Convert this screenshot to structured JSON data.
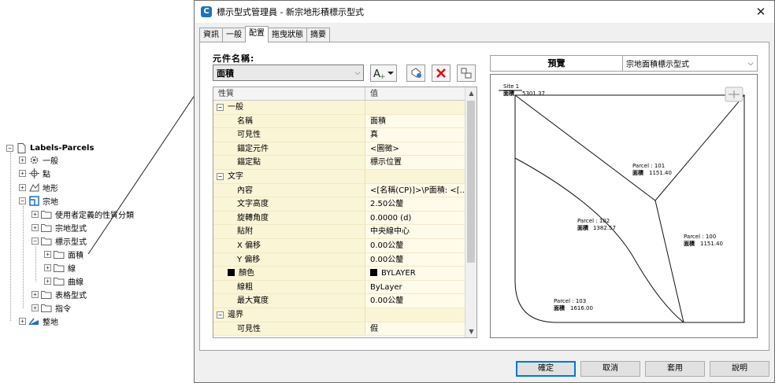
{
  "tree": {
    "root": "Labels-Parcels",
    "nodes": [
      {
        "label": "一般",
        "icon": "gear-icon"
      },
      {
        "label": "點",
        "icon": "point-icon"
      },
      {
        "label": "地形",
        "icon": "surface-icon"
      },
      {
        "label": "宗地",
        "icon": "parcel-icon"
      },
      {
        "label": "使用者定義的性質分類",
        "icon": "folder-icon"
      },
      {
        "label": "宗地型式",
        "icon": "folder-icon"
      },
      {
        "label": "標示型式",
        "icon": "folder-icon"
      },
      {
        "label": "面積",
        "icon": "folder-icon"
      },
      {
        "label": "線",
        "icon": "folder-icon"
      },
      {
        "label": "曲線",
        "icon": "folder-icon"
      },
      {
        "label": "表格型式",
        "icon": "folder-icon"
      },
      {
        "label": "指令",
        "icon": "folder-icon"
      },
      {
        "label": "整地",
        "icon": "grading-icon"
      }
    ]
  },
  "dialog": {
    "title": "標示型式管理員 - 新宗地形積標示型式",
    "tabs": [
      "資訊",
      "一般",
      "配置",
      "拖曳狀態",
      "摘要"
    ],
    "active_tab": "配置",
    "component_label": "元件名稱:",
    "component_value": "面積",
    "grid_header": {
      "property": "性質",
      "value": "值"
    },
    "rows": [
      {
        "type": "cat",
        "name": "一般",
        "value": ""
      },
      {
        "type": "prop",
        "name": "名稱",
        "value": "面積"
      },
      {
        "type": "prop",
        "name": "可見性",
        "value": "真"
      },
      {
        "type": "prop",
        "name": "錨定元件",
        "value": "<圖徵>"
      },
      {
        "type": "prop",
        "name": "錨定點",
        "value": "標示位置"
      },
      {
        "type": "cat",
        "name": "文字",
        "value": ""
      },
      {
        "type": "prop",
        "name": "內容",
        "value": "<[名稱(CP)]>\\P面積: <[..."
      },
      {
        "type": "prop",
        "name": "文字高度",
        "value": "2.50公釐"
      },
      {
        "type": "prop",
        "name": "旋轉角度",
        "value": "0.0000 (d)"
      },
      {
        "type": "prop",
        "name": "貼附",
        "value": "中央線中心"
      },
      {
        "type": "prop",
        "name": "X 偏移",
        "value": "0.00公釐"
      },
      {
        "type": "prop",
        "name": "Y 偏移",
        "value": "0.00公釐"
      },
      {
        "type": "color",
        "name": "顏色",
        "value": "BYLAYER"
      },
      {
        "type": "prop",
        "name": "線粗",
        "value": "ByLayer"
      },
      {
        "type": "prop",
        "name": "最大寬度",
        "value": "0.00公釐"
      },
      {
        "type": "cat",
        "name": "邊界",
        "value": ""
      },
      {
        "type": "prop",
        "name": "可見性",
        "value": "假"
      }
    ],
    "preview": {
      "label": "預覽",
      "style": "宗地面積標示型式",
      "site_label": "Site 1",
      "site_value": "5301.37",
      "area_prefix": "面積",
      "parcels": [
        {
          "name": "Parcel : 101",
          "area": "1151.40"
        },
        {
          "name": "Parcel : 102",
          "area": "1382.57"
        },
        {
          "name": "Parcel : 100",
          "area": "1151.40"
        },
        {
          "name": "Parcel : 103",
          "area": "1616.00"
        }
      ]
    },
    "buttons": {
      "ok": "確定",
      "cancel": "取消",
      "apply": "套用",
      "help": "說明"
    }
  }
}
